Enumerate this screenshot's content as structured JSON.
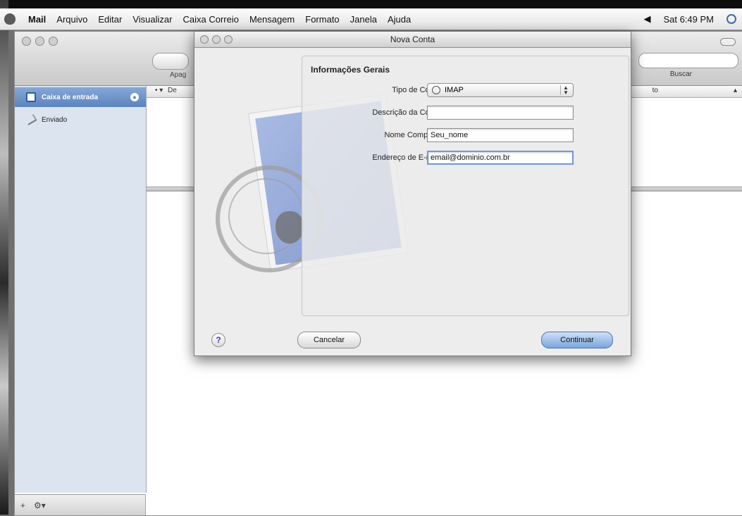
{
  "menubar": {
    "app": "Mail",
    "items": [
      "Arquivo",
      "Editar",
      "Visualizar",
      "Caixa Correio",
      "Mensagem",
      "Formato",
      "Janela",
      "Ajuda"
    ],
    "clock": "Sat 6:49 PM",
    "volume_icon": "volume-icon"
  },
  "mail_window": {
    "toolbar": {
      "button_label": "Apag",
      "search_label": "Buscar"
    },
    "sidebar": {
      "inbox_label": "Caixa de entrada",
      "sent_label": "Enviado"
    },
    "list_header": {
      "flag_col": "• ▾",
      "from_col": "De",
      "date_col": "to",
      "sort": "▴"
    },
    "bottom_bar": {
      "add": "+",
      "action": "⚙▾"
    }
  },
  "dialog": {
    "title": "Nova Conta",
    "section_title": "Informações Gerais",
    "fields": {
      "account_type": {
        "label": "Tipo de Conta:",
        "value": "IMAP"
      },
      "description": {
        "label": "Descrição da Conta:",
        "value": ""
      },
      "full_name": {
        "label": "Nome Completo:",
        "value": "Seu_nome"
      },
      "email": {
        "label": "Endereço de E-mail:",
        "value": "email@dominio.com.br"
      }
    },
    "help_label": "?",
    "cancel_label": "Cancelar",
    "continue_label": "Continuar"
  }
}
